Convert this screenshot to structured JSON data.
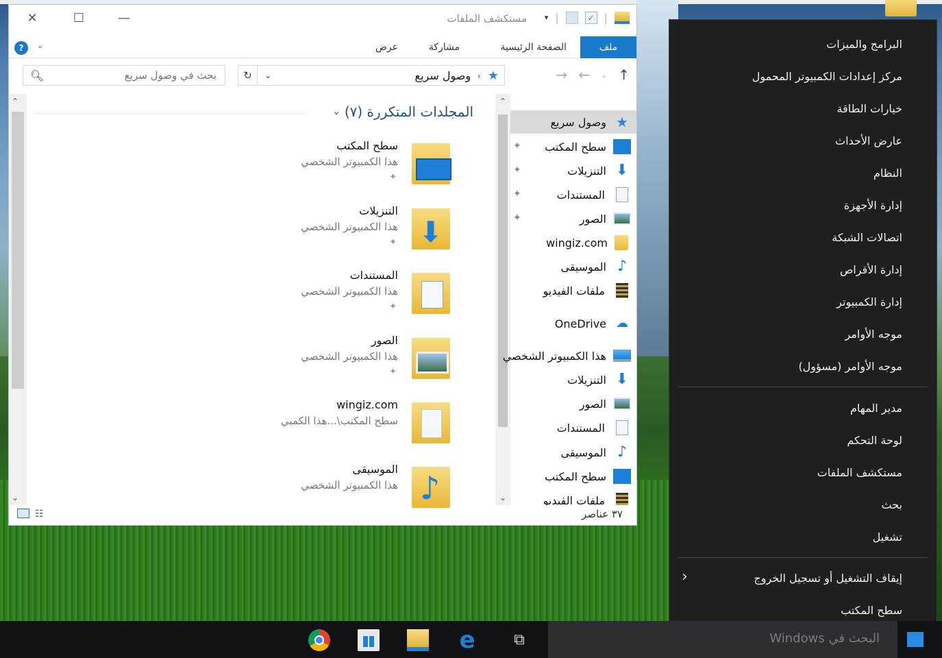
{
  "explorer": {
    "title": "مستكشف الملفات",
    "ribbon_tabs": {
      "file": "ملف",
      "home": "الصفحة الرئيسية",
      "share": "مشاركة",
      "view": "عرض"
    },
    "help_glyph": "?",
    "search_placeholder": "بحث في وصول سريع",
    "address": "وصول سريع",
    "nav_items": [
      {
        "label": "وصول سريع",
        "icon": "quick-access-star-icon"
      },
      {
        "label": "سطح المكتب",
        "icon": "desktop-icon"
      },
      {
        "label": "التنزيلات",
        "icon": "downloads-icon"
      },
      {
        "label": "المستندات",
        "icon": "documents-icon"
      },
      {
        "label": "الصور",
        "icon": "pictures-icon"
      },
      {
        "label": "wingiz.com",
        "icon": "folder-icon"
      },
      {
        "label": "الموسيقى",
        "icon": "music-icon"
      },
      {
        "label": "ملفات الفيديو",
        "icon": "videos-icon"
      },
      {
        "label": "OneDrive",
        "icon": "onedrive-icon"
      },
      {
        "label": "هذا الكمبيوتر الشخصي",
        "icon": "this-pc-icon"
      },
      {
        "label": "التنزيلات",
        "icon": "downloads-icon"
      },
      {
        "label": "الصور",
        "icon": "pictures-icon"
      },
      {
        "label": "المستندات",
        "icon": "documents-icon"
      },
      {
        "label": "الموسيقى",
        "icon": "music-icon"
      },
      {
        "label": "سطح المكتب",
        "icon": "desktop-icon"
      },
      {
        "label": "ملفات الفيديو",
        "icon": "videos-icon"
      }
    ],
    "group_header": "المجلدات المتكررة (٧)",
    "tiles": [
      {
        "name": "سطح المكتب",
        "path": "هذا الكمبيوتر الشخصي"
      },
      {
        "name": "التنزيلات",
        "path": "هذا الكمبيوتر الشخصي"
      },
      {
        "name": "المستندات",
        "path": "هذا الكمبيوتر الشخصي"
      },
      {
        "name": "الصور",
        "path": "هذا الكمبيوتر الشخصي"
      },
      {
        "name": "wingiz.com",
        "path": "سطح المكتب\\...هذا الكمبي"
      },
      {
        "name": "الموسيقى",
        "path": "هذا الكمبيوتر الشخصي"
      }
    ],
    "status_count": "٣٧ عناصر"
  },
  "winx_menu": {
    "items_group1": [
      "البرامج والميزات",
      "مركز إعدادات الكمبيوتر المحمول",
      "خيارات الطاقة",
      "عارض الأحداث",
      "النظام",
      "إدارة الأجهزة",
      "اتصالات الشبكة",
      "إدارة الأقراص",
      "إدارة الكمبيوتر",
      "موجه الأوامر",
      "موجه الأوامر (مسؤول)"
    ],
    "items_group2": [
      "مدير المهام",
      "لوحة التحكم",
      "مستكشف الملفات",
      "بحث",
      "تشغيل"
    ],
    "items_group3": [
      "إيقاف التشغيل أو تسجيل الخروج",
      "سطح المكتب"
    ]
  },
  "taskbar": {
    "search_placeholder": "البحث في Windows",
    "pinned_icons": [
      "task-view-icon",
      "edge-icon",
      "file-explorer-icon",
      "store-icon",
      "chrome-icon"
    ]
  },
  "colors": {
    "accent": "#1979ca",
    "menu_bg": "#1f1f1f",
    "taskbar_bg": "#101214"
  }
}
